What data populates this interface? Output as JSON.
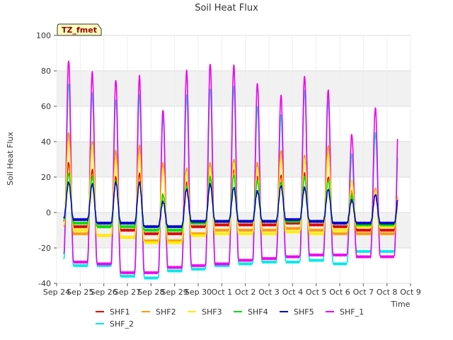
{
  "chart_data": {
    "type": "line",
    "title": "Soil Heat Flux",
    "xlabel": "Time",
    "ylabel": "Soil Heat Flux",
    "ylim": [
      -40,
      100
    ],
    "yticks": [
      -40,
      -20,
      0,
      20,
      40,
      60,
      80,
      100
    ],
    "xlim": [
      0,
      15
    ],
    "xticks": [
      "Sep 24",
      "Sep 25",
      "Sep 26",
      "Sep 27",
      "Sep 28",
      "Sep 29",
      "Sep 30",
      "Oct 1",
      "Oct 2",
      "Oct 3",
      "Oct 4",
      "Oct 5",
      "Oct 6",
      "Oct 7",
      "Oct 8",
      "Oct 9"
    ],
    "annotation": "TZ_fmet",
    "grid": true,
    "shaded_bands": [
      [
        -20,
        0
      ],
      [
        20,
        40
      ],
      [
        60,
        80
      ]
    ],
    "legend_position": "bottom",
    "data_start_day": 0.3,
    "data_end_day": 14.45,
    "peak_day_offset": 0.5,
    "series": [
      {
        "name": "SHF1",
        "color": "#dd0000",
        "peaks": [
          28,
          24,
          20,
          22,
          10,
          17,
          20,
          24,
          20,
          21,
          22,
          20,
          10,
          12
        ],
        "troughs": [
          -5,
          -8,
          -8,
          -10,
          -12,
          -12,
          -8,
          -7,
          -7,
          -7,
          -6,
          -7,
          -8,
          -10
        ]
      },
      {
        "name": "SHF2",
        "color": "#ff9900",
        "peaks": [
          45,
          40,
          35,
          38,
          28,
          25,
          28,
          30,
          28,
          35,
          32,
          38,
          12,
          14
        ],
        "troughs": [
          -8,
          -12,
          -13,
          -14,
          -16,
          -16,
          -12,
          -10,
          -10,
          -10,
          -9,
          -10,
          -12,
          -12
        ]
      },
      {
        "name": "SHF3",
        "color": "#ffee00",
        "peaks": [
          40,
          38,
          30,
          33,
          25,
          23,
          25,
          28,
          25,
          30,
          30,
          33,
          18,
          12
        ],
        "troughs": [
          -7,
          -10,
          -13,
          -14,
          -17,
          -17,
          -13,
          -12,
          -12,
          -12,
          -11,
          -12,
          -10,
          -8
        ]
      },
      {
        "name": "SHF4",
        "color": "#00dd00",
        "peaks": [
          22,
          20,
          18,
          17,
          10,
          15,
          20,
          21,
          18,
          17,
          20,
          18,
          10,
          10
        ],
        "troughs": [
          -4,
          -6,
          -8,
          -8,
          -10,
          -10,
          -6,
          -5,
          -5,
          -5,
          -5,
          -5,
          -6,
          -7
        ]
      },
      {
        "name": "SHF5",
        "color": "#0000cc",
        "peaks": [
          17,
          16,
          17,
          17,
          6,
          13,
          16,
          14,
          12,
          15,
          14,
          13,
          7,
          10
        ],
        "troughs": [
          -3,
          -4,
          -6,
          -6,
          -8,
          -8,
          -5,
          -5,
          -5,
          -5,
          -4,
          -5,
          -6,
          -6
        ]
      },
      {
        "name": "SHF_1",
        "color": "#ee00ee",
        "peaks": [
          86,
          79,
          75,
          77,
          58,
          80,
          84,
          83,
          73,
          66,
          77,
          69,
          44,
          59
        ],
        "troughs": [
          -23,
          -28,
          -29,
          -34,
          -34,
          -31,
          -30,
          -29,
          -27,
          -26,
          -25,
          -24,
          -24,
          -25
        ]
      },
      {
        "name": "SHF_2",
        "color": "#00e8e8",
        "peaks": [
          73,
          67,
          64,
          66,
          54,
          66,
          70,
          71,
          60,
          55,
          69,
          63,
          33,
          45
        ],
        "troughs": [
          -26,
          -30,
          -30,
          -36,
          -37,
          -33,
          -32,
          -30,
          -29,
          -28,
          -28,
          -27,
          -29,
          -22
        ]
      }
    ]
  }
}
